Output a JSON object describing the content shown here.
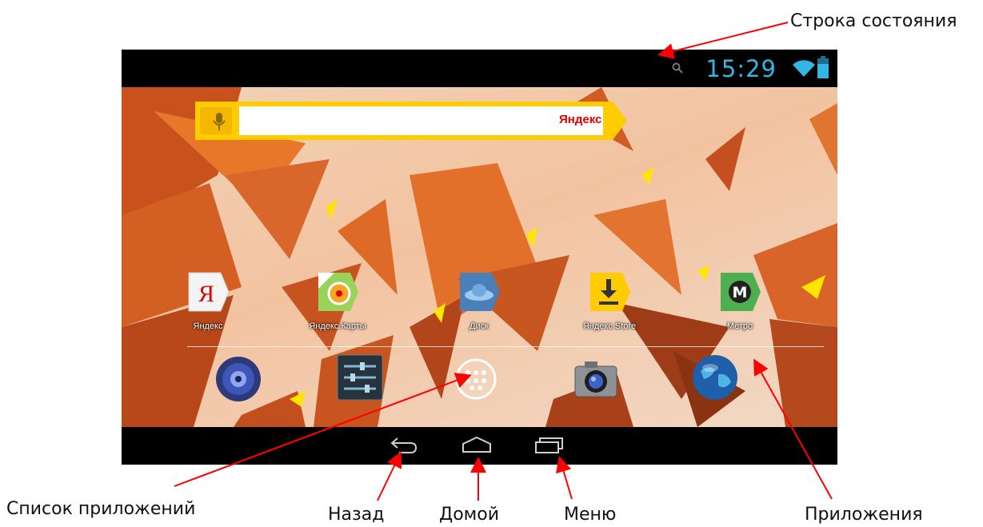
{
  "callouts": {
    "status_bar": "Строка состояния",
    "app_list": "Список приложений",
    "back": "Назад",
    "home": "Домой",
    "menu": "Меню",
    "apps": "Приложения"
  },
  "status_bar": {
    "time": "15:29",
    "icons": [
      "search-icon",
      "wifi-icon",
      "battery-icon"
    ],
    "clock_color": "#33b5e5"
  },
  "search_widget": {
    "brand": "Яндекс",
    "icons": [
      "microphone-icon"
    ]
  },
  "home_apps": [
    {
      "label": "Яндекс",
      "icon": "yandex-icon"
    },
    {
      "label": "Яндекс.Карты",
      "icon": "yandex-maps-icon"
    },
    {
      "label": "Диск",
      "icon": "disk-icon"
    },
    {
      "label": "Яндекс.Store",
      "icon": "yandex-store-icon"
    },
    {
      "label": "Метро",
      "icon": "metro-icon"
    }
  ],
  "dock": [
    "speaker-icon",
    "settings-icon",
    "app-drawer-icon",
    "camera-icon",
    "browser-globe-icon"
  ],
  "nav_buttons": [
    "back-icon",
    "home-icon",
    "recent-apps-icon"
  ],
  "colors": {
    "annotation": "#ff0000",
    "accent": "#33b5e5",
    "brand_yellow": "#ffcc00"
  }
}
